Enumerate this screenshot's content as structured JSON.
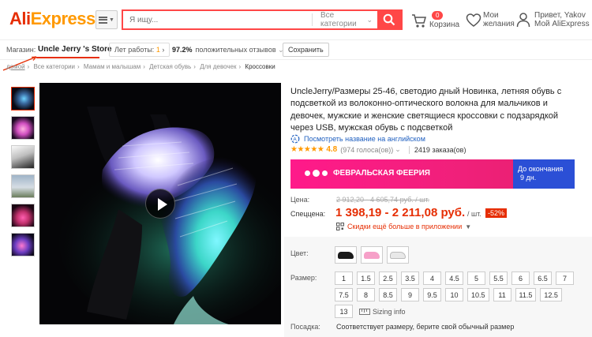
{
  "header": {
    "logo_ali": "Ali",
    "logo_express": "Express",
    "search_placeholder": "Я ищу...",
    "category_label": "Все категории",
    "cart_count": "0",
    "cart_label": "Корзина",
    "wish_line1": "Мои",
    "wish_line2": "желания",
    "user_line1": "Привет, Yakov",
    "user_line2": "Мой AliExpress",
    "icons": [
      "menu-icon",
      "search-icon",
      "cart-icon",
      "heart-icon",
      "user-icon"
    ]
  },
  "store": {
    "label": "Магазин:",
    "name": "Uncle Jerry 's Store",
    "years_label": "Лет работы:",
    "years_value": "1",
    "feedback_percent": "97.2%",
    "feedback_label": "положительных отзывов",
    "save_label": "Сохранить"
  },
  "breadcrumbs": [
    "домой",
    "Все категории",
    "Мамам и малышам",
    "Детская обувь",
    "Для девочек",
    "Кроссовки"
  ],
  "product": {
    "title": "UncleJerry/Размеры 25-46, светодио дный Новинка, летняя обувь с подсветкой из волоконно-оптического волокна для мальчиков и девочек, мужские и женские светящиеся кроссовки с подзарядкой через USB, мужская обувь с подсветкой",
    "translate_label": "Посмотреть название на английском",
    "rating_stars": "★★★★★",
    "rating_value": "4.8",
    "votes": "(974 голоса(ов))",
    "orders": "2419 заказа(ов)"
  },
  "promo": {
    "title": "ФЕВРАЛЬСКАЯ ФЕЕРИЯ",
    "countdown_line1": "До окончания",
    "countdown_line2": "9 дн."
  },
  "price": {
    "old_label": "Цена:",
    "old_value": "2 912,20 - 4 605,74 руб. / шт.",
    "new_label": "Спеццена:",
    "new_value": "1 398,19 - 2 211,08 руб.",
    "unit": "/ шт.",
    "discount": "-52%",
    "app_discount": "Скидки ещё больше в приложении"
  },
  "options": {
    "color_label": "Цвет:",
    "colors": [
      "#1a1a1a",
      "#f6a0c8",
      "#e8e8e8"
    ],
    "size_label": "Размер:",
    "sizes_row1": [
      "1",
      "1.5",
      "2.5",
      "3.5",
      "4",
      "4.5",
      "5",
      "5.5",
      "6",
      "6.5",
      "7"
    ],
    "sizes_row2": [
      "7.5",
      "8",
      "8.5",
      "9",
      "9.5",
      "10",
      "10.5",
      "11",
      "11.5",
      "12.5"
    ],
    "sizes_row3": [
      "13"
    ],
    "sizing_info": "Sizing info",
    "fit_label": "Посадка:",
    "fit_text": "Соответствует размеру, берите свой обычный размер"
  }
}
